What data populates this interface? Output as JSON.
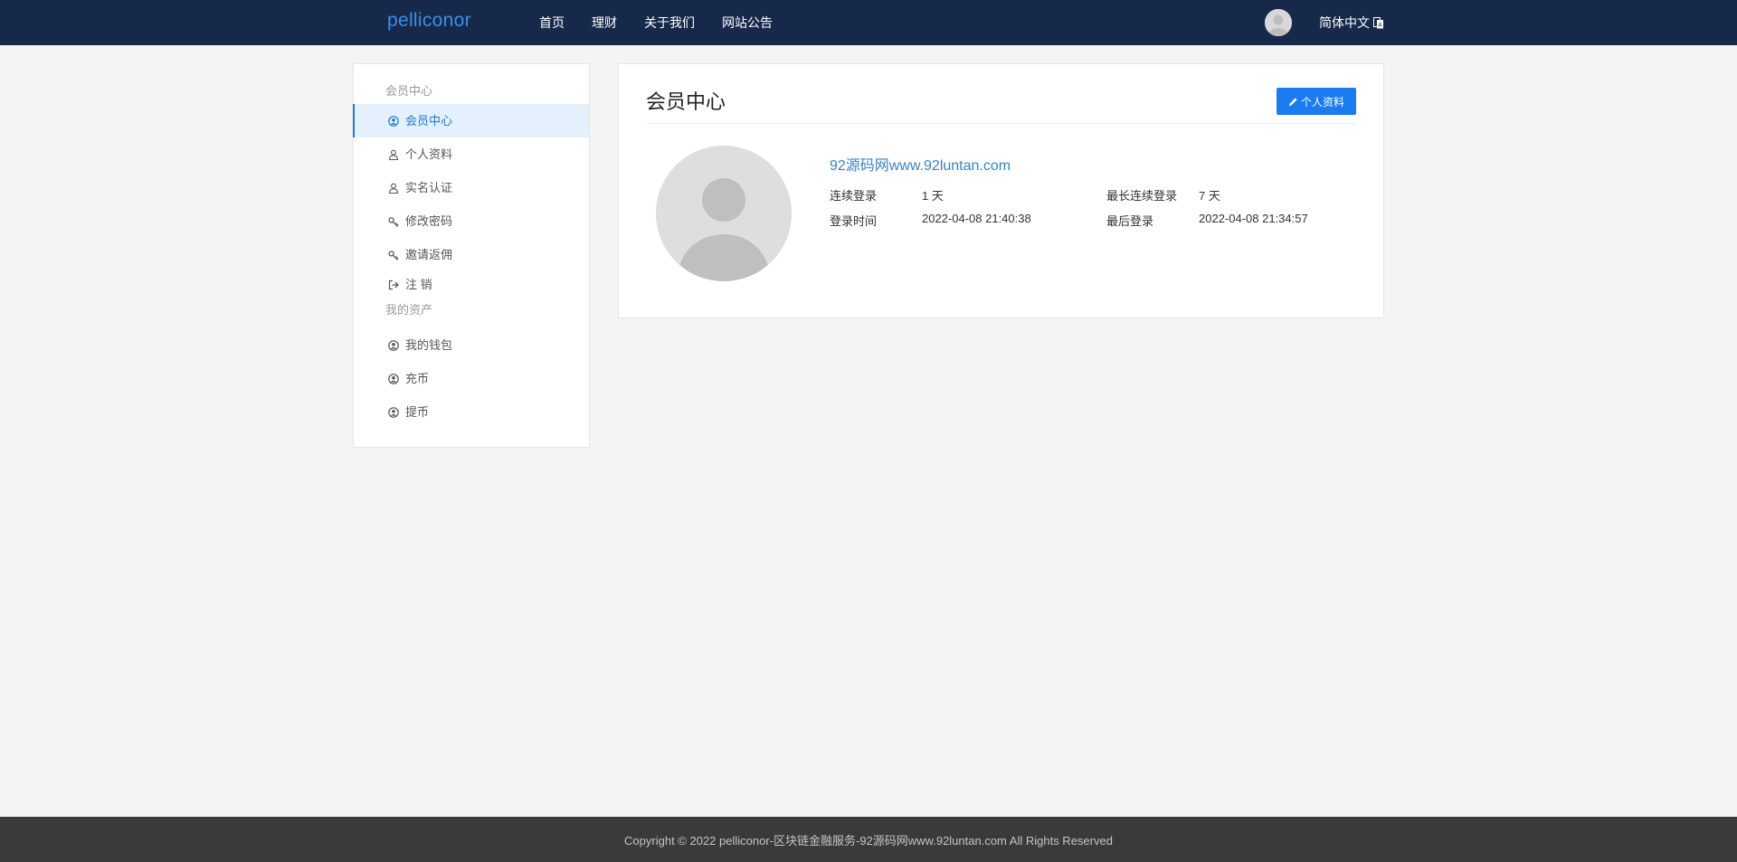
{
  "nav": {
    "brand": "pelliconor",
    "links": [
      "首页",
      "理财",
      "关于我们",
      "网站公告"
    ],
    "language": "简体中文"
  },
  "sidebar": {
    "group1": "会员中心",
    "group1_items": [
      {
        "label": "会员中心",
        "icon": "user-circle-icon",
        "active": true
      },
      {
        "label": "个人资料",
        "icon": "user-icon"
      },
      {
        "label": "实名认证",
        "icon": "user-icon"
      },
      {
        "label": "修改密码",
        "icon": "key-icon"
      },
      {
        "label": "邀请返佣",
        "icon": "key-icon"
      },
      {
        "label": "注 销",
        "icon": "sign-out-icon"
      }
    ],
    "group2": "我的资产",
    "group2_items": [
      {
        "label": "我的钱包",
        "icon": "user-circle-icon"
      },
      {
        "label": "充币",
        "icon": "user-circle-icon"
      },
      {
        "label": "提币",
        "icon": "user-circle-icon"
      }
    ]
  },
  "main": {
    "title": "会员中心",
    "profile_button": "个人资料",
    "username": "92源码网www.92luntan.com",
    "consecutive_login_label": "连续登录",
    "consecutive_login_value": "1 天",
    "longest_streak_label": "最长连续登录",
    "longest_streak_value": "7 天",
    "login_time_label": "登录时间",
    "login_time_value": "2022-04-08 21:40:38",
    "last_login_label": "最后登录",
    "last_login_value": "2022-04-08 21:34:57"
  },
  "footer": {
    "copyright": "Copyright © 2022 pelliconor-区块链金融服务-92源码网www.92luntan.com All Rights Reserved"
  },
  "colors": {
    "navbar": "#17294b",
    "brand": "#3a8ee6",
    "accent": "#1a7cf0",
    "footer": "#3a3a3a"
  }
}
